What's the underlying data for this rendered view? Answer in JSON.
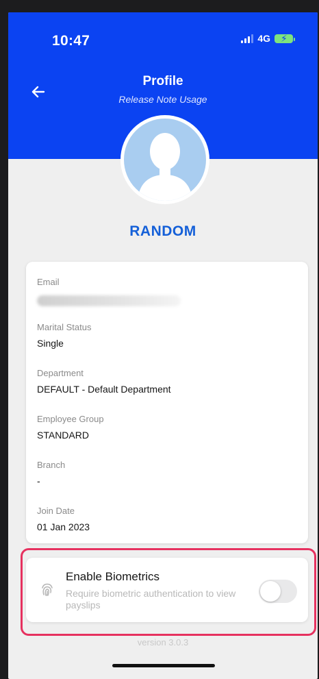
{
  "status_bar": {
    "time": "10:47",
    "network": "4G"
  },
  "header": {
    "title": "Profile",
    "subtitle": "Release Note Usage",
    "background_color": "#0b43f2"
  },
  "profile": {
    "name": "RANDOM",
    "avatar_icon": "user-silhouette-icon"
  },
  "details": [
    {
      "label": "Email",
      "value": ""
    },
    {
      "label": "Marital Status",
      "value": "Single"
    },
    {
      "label": "Department",
      "value": "DEFAULT - Default Department"
    },
    {
      "label": "Employee Group",
      "value": "STANDARD"
    },
    {
      "label": "Branch",
      "value": "-"
    },
    {
      "label": "Join Date",
      "value": "01 Jan 2023"
    }
  ],
  "biometrics": {
    "title": "Enable Biometrics",
    "description": "Require biometric authentication to view payslips",
    "icon": "fingerprint-icon",
    "enabled": false,
    "highlight_color": "#e6315f"
  },
  "version": "version 3.0.3"
}
